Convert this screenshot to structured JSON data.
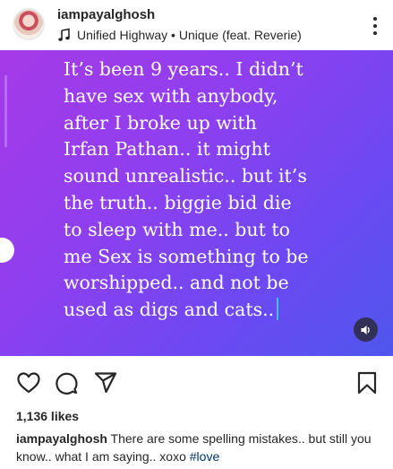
{
  "header": {
    "username": "iampayalghosh",
    "music": "Unified Highway • Unique (feat. Reverie)"
  },
  "post": {
    "lines": [
      "It’s been 9 years.. I didn’t",
      "have sex with anybody,",
      "after I broke up with",
      "Irfan Pathan.. it might",
      "sound unrealistic.. but  it’s",
      "the truth.. biggie bid die",
      "to sleep with me.. but to",
      "me Sex is something to be",
      "worshipped.. and not be",
      "used as digs and  cats.."
    ],
    "gradient_colors": [
      "#a53ae7",
      "#8f3ff0",
      "#6b49f2",
      "#4f56ee"
    ],
    "cursor_color": "#3ec3ff"
  },
  "actions": {
    "icons": [
      "heart-icon",
      "comment-icon",
      "share-icon",
      "bookmark-icon"
    ]
  },
  "likes": "1,136 likes",
  "caption": {
    "username": "iampayalghosh",
    "text": " There are some spelling mistakes.. but still you know.. what I am saying.. xoxo ",
    "hashtag": "#love"
  },
  "colors": {
    "text": "#262626",
    "link": "#00376b",
    "background": "#ffffff"
  }
}
